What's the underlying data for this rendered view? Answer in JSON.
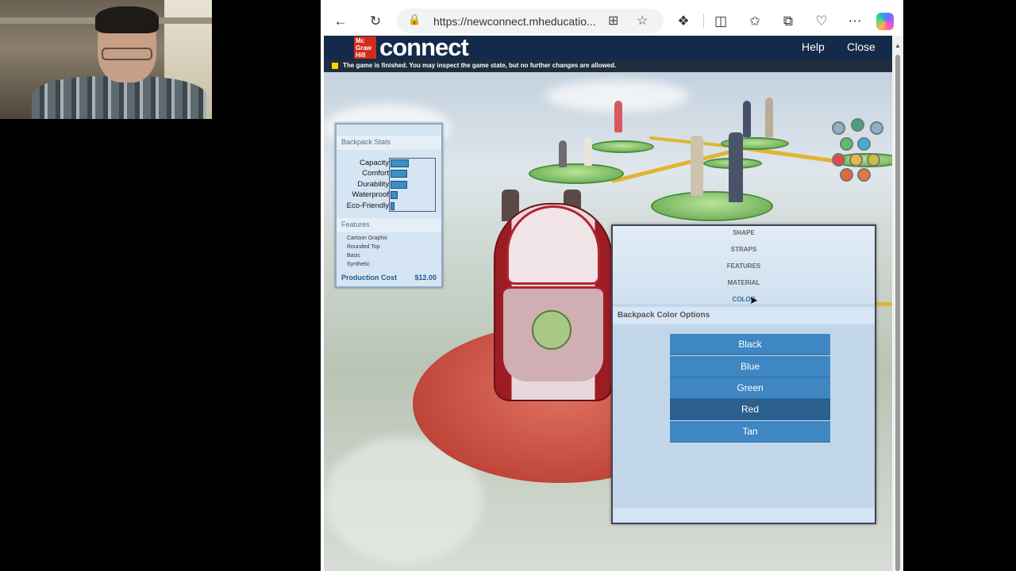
{
  "browser": {
    "url": "https://newconnect.mheducatio..."
  },
  "header": {
    "logo_small": "Mc Graw Hill",
    "logo_text": "connect",
    "help_label": "Help",
    "close_label": "Close"
  },
  "notice": "The game is finished. You may inspect the game state, but no further changes are allowed.",
  "stats": {
    "title": "Backpack Stats",
    "rows": [
      {
        "label": "Capacity",
        "value": 0.42
      },
      {
        "label": "Comfort",
        "value": 0.38
      },
      {
        "label": "Durability",
        "value": 0.38
      },
      {
        "label": "Waterproof",
        "value": 0.16
      },
      {
        "label": "Eco-Friendly",
        "value": 0.08
      }
    ],
    "features_title": "Features",
    "features": [
      "Cartoon Graphic",
      "Rounded Top",
      "Basic",
      "Synthetic"
    ],
    "cost_label": "Production Cost",
    "cost_value": "$12.00"
  },
  "panel": {
    "menu": [
      "SHAPE",
      "STRAPS",
      "FEATURES",
      "MATERIAL",
      "COLOR"
    ],
    "active_menu": "COLOR",
    "options_title": "Backpack Color Options",
    "colors": [
      "Black",
      "Blue",
      "Green",
      "Red",
      "Tan"
    ],
    "selected_color": "Red"
  }
}
